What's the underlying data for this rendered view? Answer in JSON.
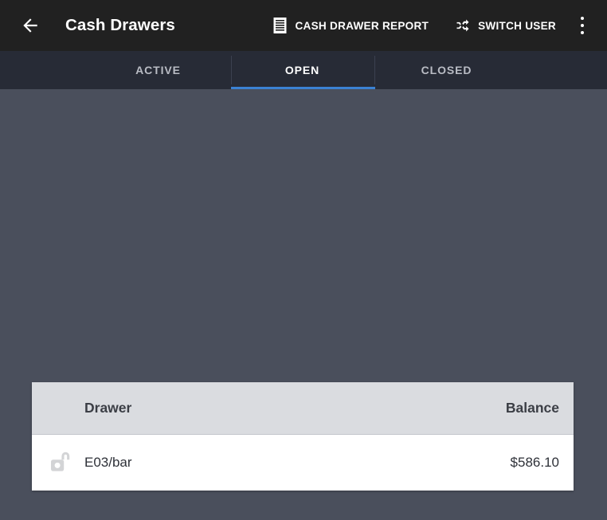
{
  "appbar": {
    "back_icon": "arrow-back-icon",
    "title": "Cash Drawers",
    "actions": [
      {
        "icon": "document-report-icon",
        "label": "CASH DRAWER REPORT"
      },
      {
        "icon": "shuffle-icon",
        "label": "SWITCH USER"
      }
    ],
    "overflow_icon": "more-vertical-icon"
  },
  "tabs": [
    {
      "label": "ACTIVE",
      "selected": false
    },
    {
      "label": "OPEN",
      "selected": true
    },
    {
      "label": "CLOSED",
      "selected": false
    }
  ],
  "table": {
    "columns": {
      "drawer": "Drawer",
      "balance": "Balance"
    },
    "rows": [
      {
        "status_icon": "unlocked-padlock-icon",
        "name": "E03/bar",
        "balance": "$586.10"
      }
    ]
  },
  "colors": {
    "appbar_bg": "#212121",
    "tabbar_bg": "#272b36",
    "content_bg": "#4a4f5c",
    "tab_indicator": "#3b82d4",
    "card_header_bg": "#dadce0",
    "card_bg": "#ffffff",
    "lock_icon": "#d3d4d6"
  }
}
